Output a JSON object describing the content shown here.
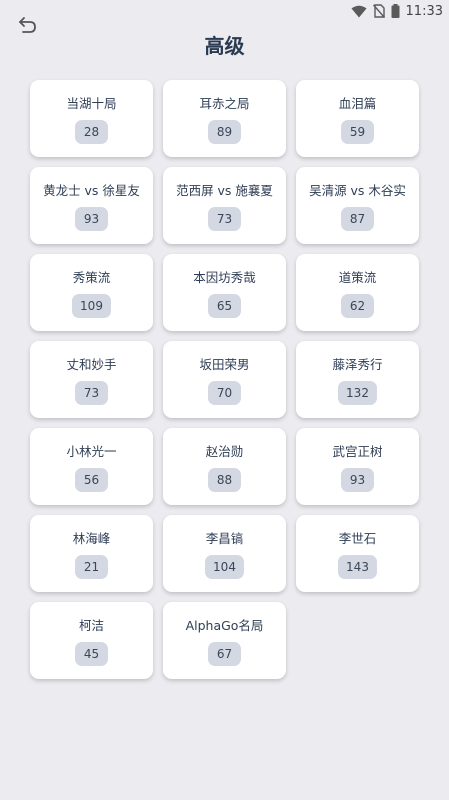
{
  "status_bar": {
    "time": "11:33"
  },
  "header": {
    "title": "高级"
  },
  "items": [
    {
      "title": "当湖十局",
      "count": "28"
    },
    {
      "title": "耳赤之局",
      "count": "89"
    },
    {
      "title": "血泪篇",
      "count": "59"
    },
    {
      "title": "黄龙士 vs 徐星友",
      "count": "93"
    },
    {
      "title": "范西屏 vs 施襄夏",
      "count": "73"
    },
    {
      "title": "吴清源 vs 木谷实",
      "count": "87"
    },
    {
      "title": "秀策流",
      "count": "109"
    },
    {
      "title": "本因坊秀哉",
      "count": "65"
    },
    {
      "title": "道策流",
      "count": "62"
    },
    {
      "title": "丈和妙手",
      "count": "73"
    },
    {
      "title": "坂田荣男",
      "count": "70"
    },
    {
      "title": "藤泽秀行",
      "count": "132"
    },
    {
      "title": "小林光一",
      "count": "56"
    },
    {
      "title": "赵治勋",
      "count": "88"
    },
    {
      "title": "武宫正树",
      "count": "93"
    },
    {
      "title": "林海峰",
      "count": "21"
    },
    {
      "title": "李昌镐",
      "count": "104"
    },
    {
      "title": "李世石",
      "count": "143"
    },
    {
      "title": "柯洁",
      "count": "45"
    },
    {
      "title": "AlphaGo名局",
      "count": "67"
    }
  ]
}
